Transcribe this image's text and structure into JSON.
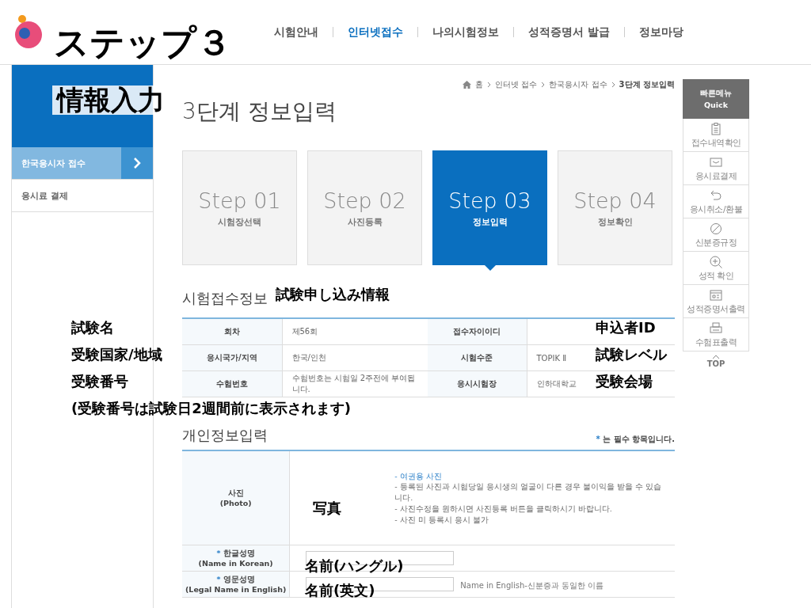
{
  "header": {
    "nav": [
      {
        "label": "시험안내",
        "selected": false
      },
      {
        "label": "인터넷접수",
        "selected": true
      },
      {
        "label": "나의시험정보",
        "selected": false
      },
      {
        "label": "성적증명서 발급",
        "selected": false
      },
      {
        "label": "정보마당",
        "selected": false
      }
    ]
  },
  "sidebar": {
    "items": [
      {
        "label": "한국응시자 접수",
        "selected": true
      },
      {
        "label": "응시료 결제",
        "selected": false
      }
    ]
  },
  "breadcrumb": [
    "홈",
    "인터넷 접수",
    "한국응시자 접수",
    "3단계 정보입력"
  ],
  "page_title": "3단계 정보입력",
  "steps": [
    {
      "label": "Step 01",
      "caption": "시험장선택",
      "selected": false
    },
    {
      "label": "Step 02",
      "caption": "사진등록",
      "selected": false
    },
    {
      "label": "Step 03",
      "caption": "정보입력",
      "selected": true
    },
    {
      "label": "Step 04",
      "caption": "정보확인",
      "selected": false
    }
  ],
  "exam_info": {
    "title": "시험접수정보",
    "rows": [
      [
        "회차",
        "제56회",
        "접수자이이디",
        ""
      ],
      [
        "응시국가/지역",
        "한국/인천",
        "시험수준",
        "TOPIK Ⅱ"
      ],
      [
        "수험번호",
        "수험번호는 시험일 2주전에 부여됩니다.",
        "응시시험장",
        "인하대학교"
      ]
    ]
  },
  "personal_info": {
    "title": "개인정보입력",
    "required_mark": "*",
    "required_note": "는 필수 항목입니다.",
    "photo": {
      "label": "사진",
      "sublabel": "(Photo)",
      "notes": [
        {
          "text": "- 여권용 사진",
          "kind": "link"
        },
        {
          "text": "- 등록된 사진과 시험당일 응시생의 얼굴이 다른 경우 불이익을 받을 수 있습니다.",
          "kind": "plain"
        },
        {
          "text": "- 사진수정을 원하시면 사진등록 버튼을 클릭하시기 바랍니다.",
          "kind": "plain"
        },
        {
          "text": "- 사진 미 등록시 응시 불가",
          "kind": "plain"
        }
      ]
    },
    "fields": [
      {
        "label": "한글성명",
        "sublabel": "(Name in Korean)",
        "required": true
      },
      {
        "label": "영문성명",
        "sublabel": "(Legal Name in English)",
        "required": true,
        "hint": "Name in English-신분증과 동일한 이름"
      }
    ]
  },
  "quick_menu": {
    "title": "빠른메뉴",
    "subtitle": "Quick",
    "items": [
      {
        "label": "접수내역확인"
      },
      {
        "label": "응시료결제"
      },
      {
        "label": "응시취소/환불"
      },
      {
        "label": "신분증규정"
      },
      {
        "label": "성적 확인"
      },
      {
        "label": "성적증명서출력"
      },
      {
        "label": "수험표출력"
      }
    ],
    "top": "TOP"
  },
  "annotations": [
    {
      "text": "ステップ３",
      "kind": "title"
    },
    {
      "text": "情報入力",
      "kind": "title"
    },
    {
      "text": "試験申し込み情報",
      "kind": "note"
    },
    {
      "text": "試験名",
      "kind": "note"
    },
    {
      "text": "受験国家/地域",
      "kind": "note"
    },
    {
      "text": "受験番号",
      "kind": "note"
    },
    {
      "text": "(受験番号は試験日2週間前に表示されます)",
      "kind": "note"
    },
    {
      "text": "申込者ID",
      "kind": "note"
    },
    {
      "text": "試験レベル",
      "kind": "note"
    },
    {
      "text": "受験会場",
      "kind": "note"
    },
    {
      "text": "写真",
      "kind": "note"
    },
    {
      "text": "名前(ハングル)",
      "kind": "note"
    },
    {
      "text": "名前(英文)",
      "kind": "note"
    }
  ]
}
